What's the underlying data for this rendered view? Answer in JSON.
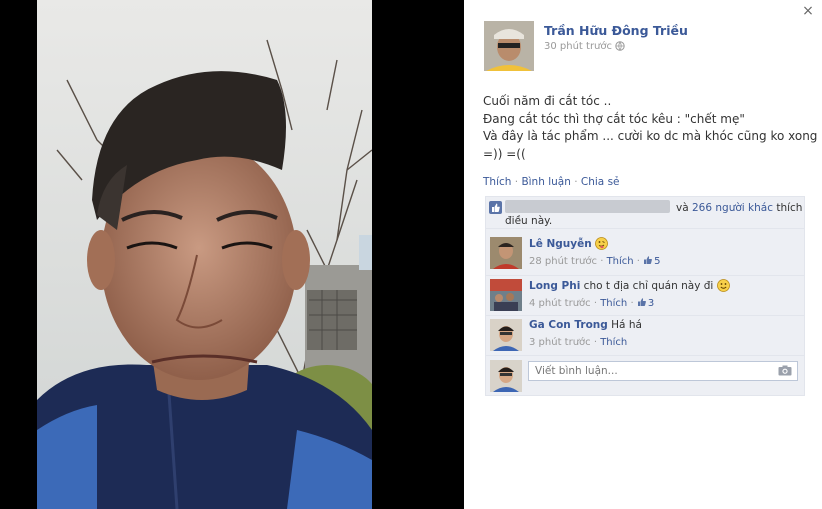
{
  "close_label": "×",
  "author": {
    "name": "Trần Hữu Đông Triều",
    "time": "30 phút trước"
  },
  "post": {
    "lines": [
      "Cuối năm đi cắt tóc ..",
      "Đang cắt tóc thì thợ cắt tóc kêu : \"chết mẹ\"",
      "Và đây là tác phẩm ... cười ko dc mà khóc cũng ko xong",
      "=)) =(("
    ]
  },
  "actions": {
    "like": "Thích",
    "comment": "Bình luận",
    "share": "Chia sẻ",
    "separator": " · "
  },
  "likes": {
    "and": "và",
    "others": "266 người khác",
    "like": "thích",
    "suffix": "điều này."
  },
  "comments": [
    {
      "author": "Lê Nguyễn",
      "text": "",
      "time": "28 phút trước",
      "like": "Thích",
      "likes": "5",
      "emoji": "face-tongue-icon"
    },
    {
      "author": "Long Phi",
      "text": "cho t địa chỉ quán này đi",
      "time": "4 phút trước",
      "like": "Thích",
      "likes": "3",
      "emoji": "smiley-icon"
    },
    {
      "author": "Ga Con Trong",
      "text": "Há há",
      "time": "3 phút trước",
      "like": "Thích",
      "likes": "",
      "emoji": ""
    }
  ],
  "compose": {
    "placeholder": "Viết bình luận..."
  },
  "colors": {
    "link": "#3b5998",
    "ufi_bg": "#edeff4",
    "stage_bg": "#000000",
    "muted": "#999999"
  }
}
